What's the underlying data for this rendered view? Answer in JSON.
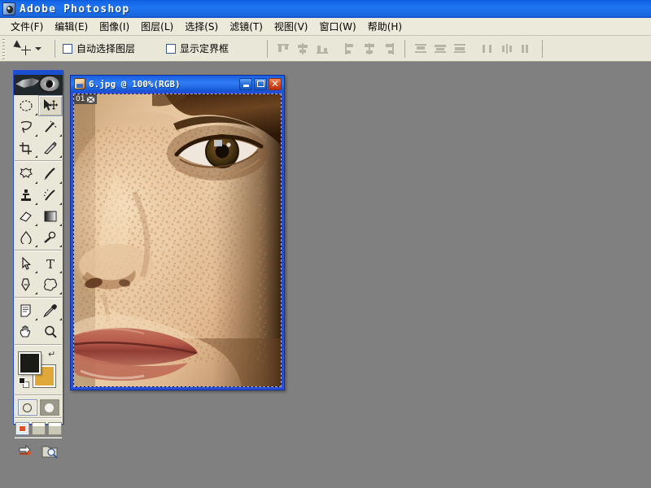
{
  "app": {
    "title": "Adobe Photoshop",
    "icon": "photoshop-icon"
  },
  "menubar": {
    "items": [
      {
        "label": "文件(F)"
      },
      {
        "label": "编辑(E)"
      },
      {
        "label": "图像(I)"
      },
      {
        "label": "图层(L)"
      },
      {
        "label": "选择(S)"
      },
      {
        "label": "滤镜(T)"
      },
      {
        "label": "视图(V)"
      },
      {
        "label": "窗口(W)"
      },
      {
        "label": "帮助(H)"
      }
    ]
  },
  "options_bar": {
    "active_tool": "move-tool",
    "auto_select_layer": {
      "label": "自动选择图层",
      "checked": false
    },
    "show_bounding_box": {
      "label": "显示定界框",
      "checked": false
    },
    "align_buttons": [
      "align-top-edges",
      "align-vertical-centers",
      "align-bottom-edges",
      "align-left-edges",
      "align-horizontal-centers",
      "align-right-edges"
    ],
    "distribute_buttons": [
      "distribute-top-edges",
      "distribute-vertical-centers",
      "distribute-bottom-edges",
      "distribute-left-edges",
      "distribute-horizontal-centers",
      "distribute-right-edges"
    ]
  },
  "toolbox": {
    "tools": [
      {
        "name": "marquee-tool",
        "selected": false
      },
      {
        "name": "move-tool",
        "selected": true
      },
      {
        "name": "lasso-tool",
        "selected": false
      },
      {
        "name": "magic-wand-tool",
        "selected": false
      },
      {
        "name": "crop-tool",
        "selected": false
      },
      {
        "name": "slice-tool",
        "selected": false
      },
      {
        "name": "healing-brush-tool",
        "selected": false
      },
      {
        "name": "brush-tool",
        "selected": false
      },
      {
        "name": "clone-stamp-tool",
        "selected": false
      },
      {
        "name": "history-brush-tool",
        "selected": false
      },
      {
        "name": "eraser-tool",
        "selected": false
      },
      {
        "name": "gradient-tool",
        "selected": false
      },
      {
        "name": "blur-tool",
        "selected": false
      },
      {
        "name": "dodge-tool",
        "selected": false
      },
      {
        "name": "path-selection-tool",
        "selected": false
      },
      {
        "name": "type-tool",
        "selected": false
      },
      {
        "name": "pen-tool",
        "selected": false
      },
      {
        "name": "custom-shape-tool",
        "selected": false
      },
      {
        "name": "notes-tool",
        "selected": false
      },
      {
        "name": "eyedropper-tool",
        "selected": false
      },
      {
        "name": "hand-tool",
        "selected": false
      },
      {
        "name": "zoom-tool",
        "selected": false
      }
    ],
    "colors": {
      "foreground": "#1a1a16",
      "background": "#e0a838"
    },
    "quick_mask": {
      "standard_selected": true
    },
    "screen_modes": {
      "active_index": 0
    },
    "jump_buttons": [
      "jump-to-imageready",
      "jump-to-file-browser"
    ]
  },
  "document_window": {
    "title": "6.jpg @ 100%(RGB)",
    "buttons": {
      "minimize": "minimize-button",
      "maximize": "maximize-button",
      "close": "close-button"
    },
    "slice_badge": {
      "number": "01",
      "icon": "slice-image-icon"
    },
    "image_subject": "close-up portrait of freckled face"
  },
  "workspace": {
    "background_color": "#808080"
  }
}
